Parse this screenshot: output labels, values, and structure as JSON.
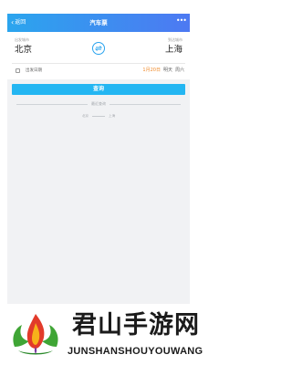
{
  "header": {
    "back_label": "返回",
    "title": "汽车票",
    "more_label": "•••"
  },
  "route": {
    "from_label": "出发城市",
    "from_city": "北京",
    "to_label": "到达城市",
    "to_city": "上海"
  },
  "date": {
    "label": "出发日期",
    "value": "1月20日",
    "day_relative": "明天",
    "weekday": "周六"
  },
  "search": {
    "button_label": "查询"
  },
  "recent": {
    "label": "最近查询",
    "items": [
      {
        "from": "北京",
        "to": "上海"
      }
    ]
  },
  "watermark": {
    "title": "君山手游网",
    "subtitle": "JUNSHANSHOUYOUWANG"
  },
  "colors": {
    "header_gradient_start": "#2ba5ee",
    "header_gradient_end": "#4d79f2",
    "search_button": "#24b6f2",
    "date_accent": "#f08a2a",
    "page_background": "#f1f2f4"
  }
}
